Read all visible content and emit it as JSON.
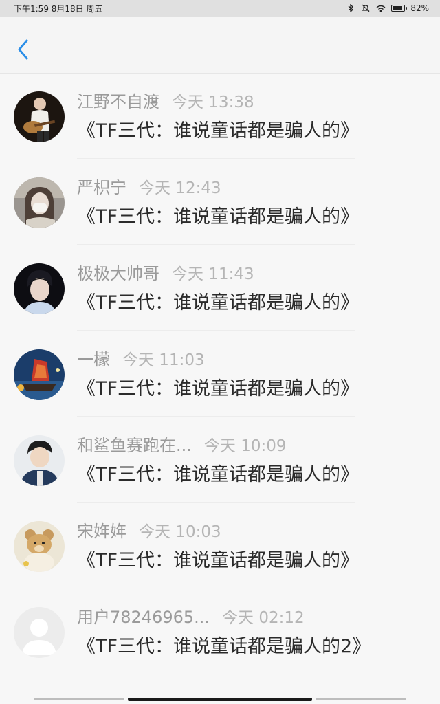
{
  "status_bar": {
    "left_text": "下午1:59  8月18日 周五",
    "battery": "82%",
    "battery_level": 0.82,
    "icons": [
      "bluetooth-icon",
      "mute-bell-icon",
      "wifi-icon",
      "battery-icon"
    ]
  },
  "header": {
    "back_icon": "chevron-left-icon",
    "accent_color": "#2a8ee8"
  },
  "comments": [
    {
      "user": "江野不自渡",
      "time": "今天 13:38",
      "text": "《TF三代：谁说童话都是骗人的》",
      "avatar": "guitar-photo"
    },
    {
      "user": "严枳宁",
      "time": "今天 12:43",
      "text": "《TF三代：谁说童话都是骗人的》",
      "avatar": "masked-girl-photo"
    },
    {
      "user": "极极大帅哥",
      "time": "今天 11:43",
      "text": "《TF三代：谁说童话都是骗人的》",
      "avatar": "boy-photo"
    },
    {
      "user": "一檬",
      "time": "今天 11:03",
      "text": "《TF三代：谁说童话都是骗人的》",
      "avatar": "ship-photo"
    },
    {
      "user": "和鲨鱼赛跑在...",
      "time": "今天 10:09",
      "text": "《TF三代：谁说童话都是骗人的》",
      "avatar": "kid-photo"
    },
    {
      "user": "宋姩姩",
      "time": "今天 10:03",
      "text": "《TF三代：谁说童话都是骗人的》",
      "avatar": "teddy-bear-photo"
    },
    {
      "user": "用户78246965...",
      "time": "今天 02:12",
      "text": "《TF三代：谁说童话都是骗人的2》",
      "avatar": "default-avatar"
    }
  ]
}
